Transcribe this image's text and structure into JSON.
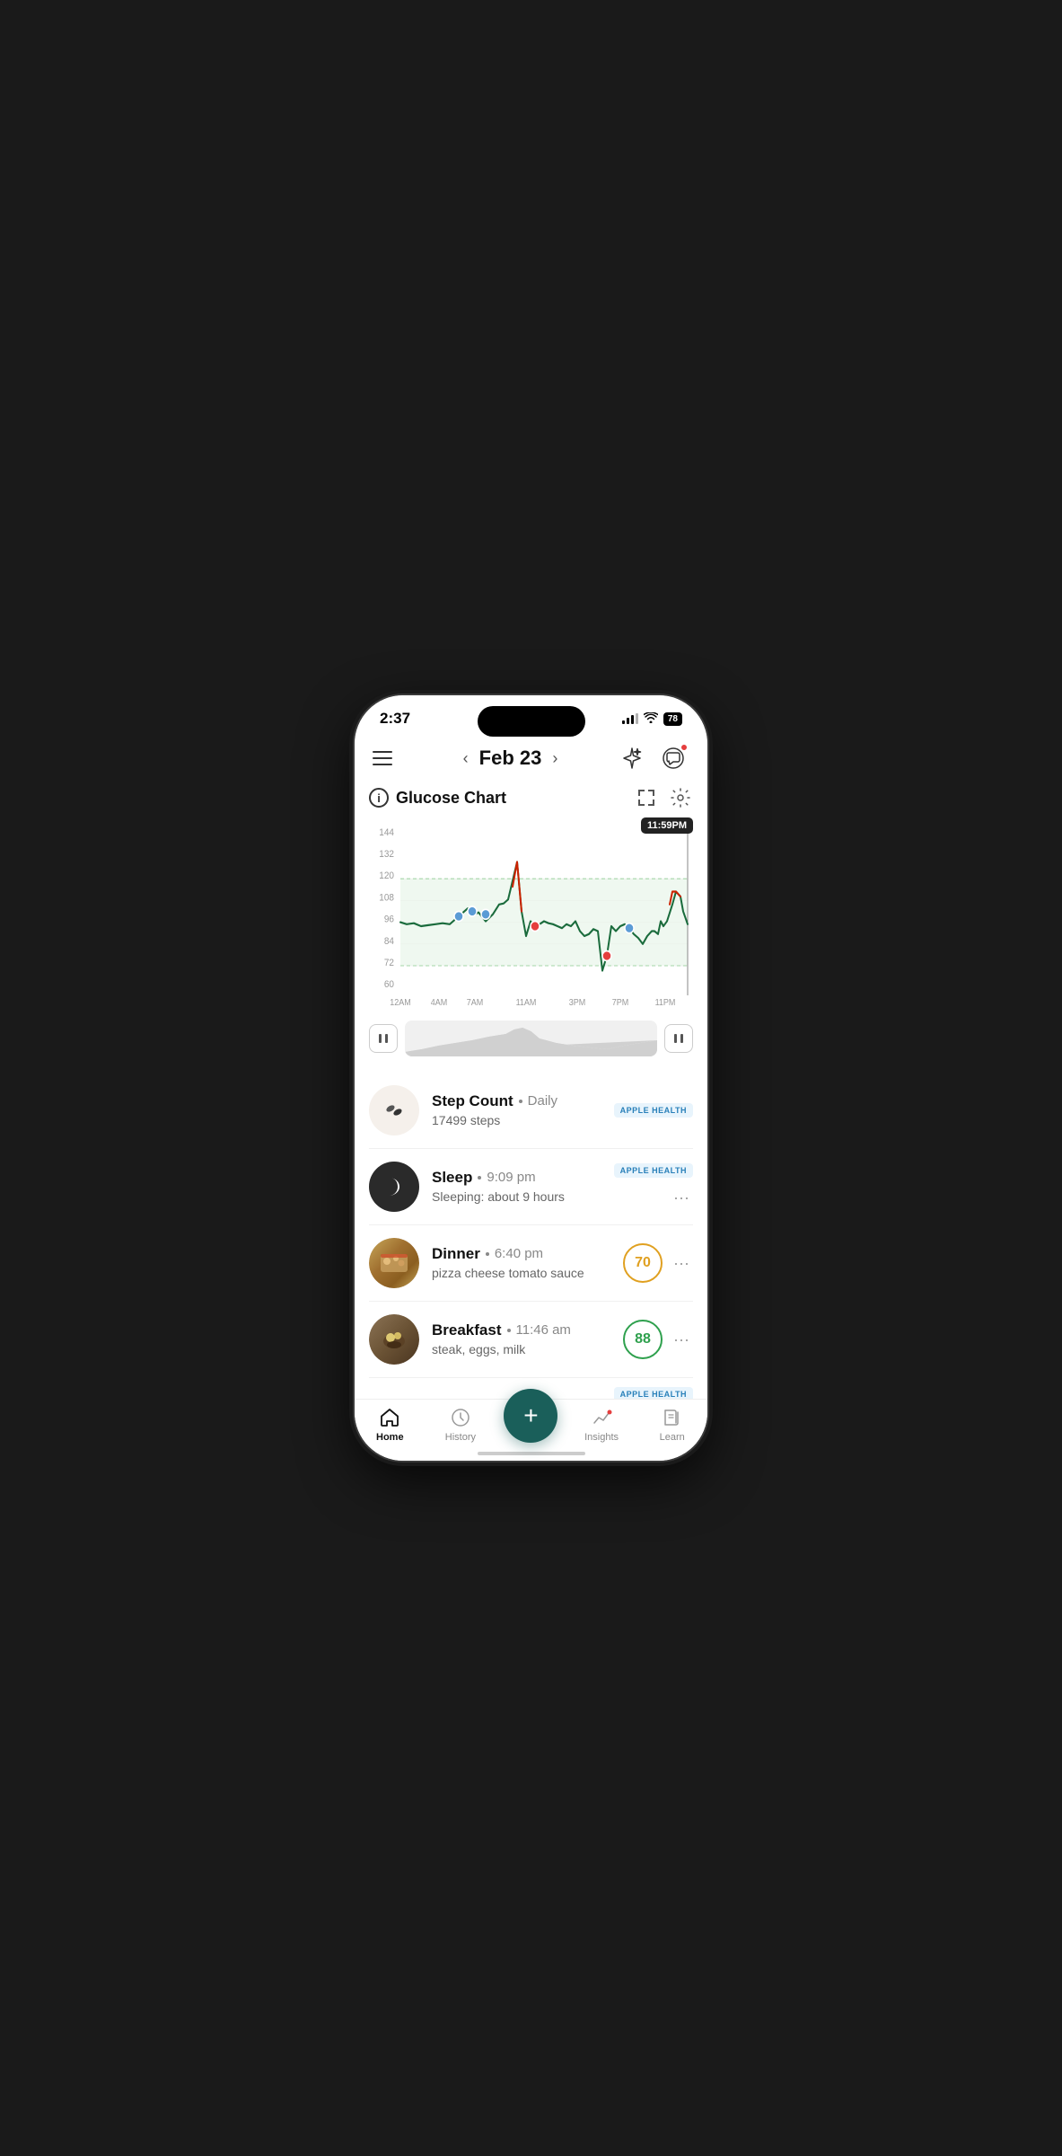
{
  "statusBar": {
    "time": "2:37",
    "battery": "78"
  },
  "header": {
    "menuLabel": "Menu",
    "date": "Feb 23",
    "sparkleLabel": "AI",
    "chatLabel": "Chat"
  },
  "chart": {
    "title": "Glucose Chart",
    "infoLabel": "i",
    "timeTooltip": "11:59PM",
    "yAxisLabels": [
      "144",
      "132",
      "120",
      "108",
      "96",
      "84",
      "72",
      "60"
    ],
    "xAxisLabels": [
      "12AM",
      "4AM",
      "7AM",
      "11AM",
      "3PM",
      "7PM",
      "11PM"
    ],
    "rangeMin": 72,
    "rangeMax": 120,
    "expandLabel": "Expand",
    "settingsLabel": "Settings"
  },
  "scrubber": {
    "playLabel": "Pause",
    "pauseLabel": "Pause"
  },
  "activities": [
    {
      "id": "step-count",
      "title": "Step Count",
      "timeLabel": "Daily",
      "subtitle": "17499 steps",
      "badge": "APPLE HEALTH",
      "score": null,
      "iconType": "steps",
      "hasMore": false
    },
    {
      "id": "sleep",
      "title": "Sleep",
      "timeLabel": "9:09 pm",
      "subtitle": "Sleeping: about 9 hours",
      "badge": "APPLE HEALTH",
      "score": null,
      "iconType": "moon",
      "hasMore": true
    },
    {
      "id": "dinner",
      "title": "Dinner",
      "timeLabel": "6:40 pm",
      "subtitle": "pizza cheese tomato sauce",
      "badge": null,
      "score": "70",
      "scoreColor": "yellow",
      "iconType": "dinner-food",
      "hasMore": true
    },
    {
      "id": "breakfast",
      "title": "Breakfast",
      "timeLabel": "11:46 am",
      "subtitle": "steak, eggs, milk",
      "badge": null,
      "score": "88",
      "scoreColor": "green",
      "iconType": "breakfast-food",
      "hasMore": true
    },
    {
      "id": "apple-health-partial",
      "title": "",
      "timeLabel": "",
      "subtitle": "",
      "badge": "APPLE HEALTH",
      "score": null,
      "iconType": "hidden",
      "hasMore": false
    }
  ],
  "bottomNav": {
    "items": [
      {
        "id": "home",
        "label": "Home",
        "active": true,
        "icon": "home-icon"
      },
      {
        "id": "history",
        "label": "History",
        "active": false,
        "icon": "history-icon"
      },
      {
        "id": "add",
        "label": "",
        "active": false,
        "icon": "add-icon"
      },
      {
        "id": "insights",
        "label": "Insights",
        "active": false,
        "icon": "insights-icon",
        "hasDot": true
      },
      {
        "id": "learn",
        "label": "Learn",
        "active": false,
        "icon": "learn-icon"
      }
    ]
  }
}
